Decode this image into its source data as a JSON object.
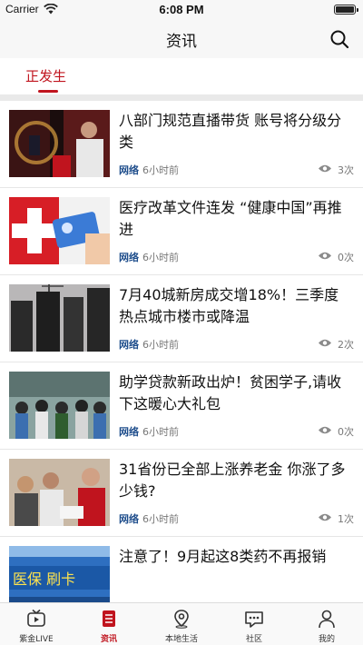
{
  "status_bar": {
    "carrier": "Carrier",
    "time": "6:08 PM"
  },
  "nav": {
    "title": "资讯"
  },
  "tabs": [
    {
      "label": "正发生",
      "active": true
    }
  ],
  "news": [
    {
      "title": "八部门规范直播带货 账号将分级分类",
      "source": "网络",
      "age": "6小时前",
      "views": "3次"
    },
    {
      "title": "医疗改革文件连发 “健康中国”再推进",
      "source": "网络",
      "age": "6小时前",
      "views": "0次"
    },
    {
      "title": "7月40城新房成交增18%！三季度热点城市楼市或降温",
      "source": "网络",
      "age": "6小时前",
      "views": "2次"
    },
    {
      "title": "助学贷款新政出炉！贫困学子,请收下这暖心大礼包",
      "source": "网络",
      "age": "6小时前",
      "views": "0次"
    },
    {
      "title": "31省份已全部上涨养老金 你涨了多少钱?",
      "source": "网络",
      "age": "6小时前",
      "views": "1次"
    },
    {
      "title": "注意了！9月起这8类药不再报销",
      "source": "",
      "age": "",
      "views": "",
      "thumb_text": "医保 刷卡"
    }
  ],
  "tabbar": [
    {
      "label": "紫金LIVE",
      "icon": "tv-icon"
    },
    {
      "label": "资讯",
      "icon": "news-icon",
      "active": true
    },
    {
      "label": "本地生活",
      "icon": "location-pin-icon"
    },
    {
      "label": "社区",
      "icon": "chat-bubble-icon"
    },
    {
      "label": "我的",
      "icon": "person-icon"
    }
  ],
  "colors": {
    "accent": "#c0141e",
    "source": "#1f4e8c",
    "divider": "#e9e9e9"
  }
}
